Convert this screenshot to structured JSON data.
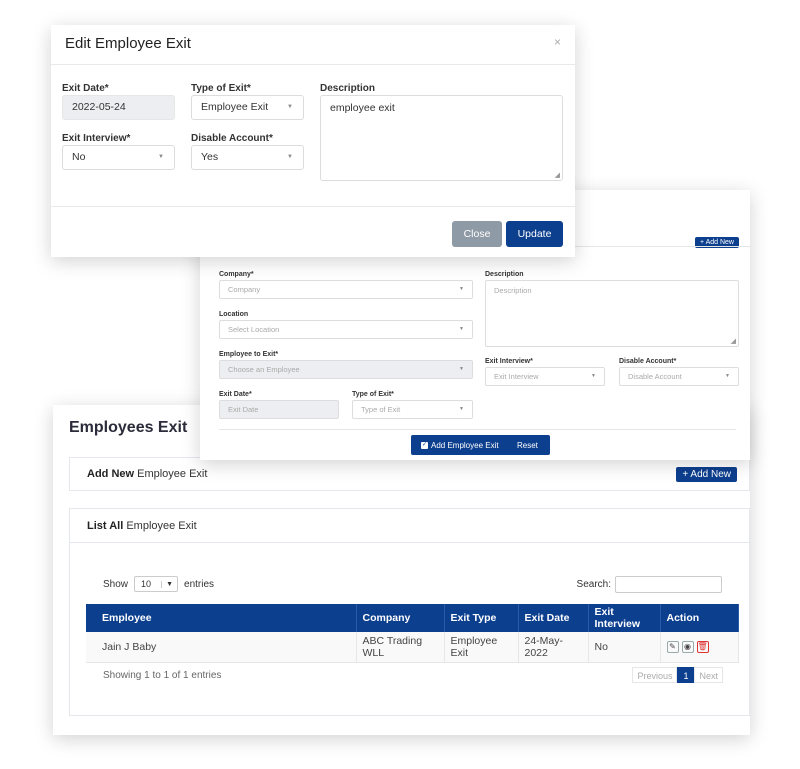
{
  "list_card": {
    "title": "Employees Exit",
    "add_panel": {
      "title_bold": "Add New",
      "title_rest": " Employee Exit",
      "add_button": "+ Add New"
    },
    "list_panel": {
      "title_bold": "List All",
      "title_rest": " Employee Exit"
    },
    "length": {
      "show": "Show",
      "value": "10",
      "entries": "entries"
    },
    "search": {
      "label": "Search:",
      "value": ""
    },
    "table": {
      "headers": [
        "Employee",
        "Company",
        "Exit Type",
        "Exit Date",
        "Exit Interview",
        "Action"
      ],
      "rows": [
        {
          "employee": "Jain J Baby",
          "company": "ABC Trading WLL",
          "exit_type": "Employee Exit",
          "exit_date": "24-May-2022",
          "exit_interview": "No"
        }
      ]
    },
    "info": "Showing 1 to 1 of 1 entries",
    "pager": {
      "previous": "Previous",
      "current": "1",
      "next": "Next"
    }
  },
  "add_form": {
    "add_button": "+ Add New",
    "company": {
      "label": "Company*",
      "placeholder": "Company"
    },
    "location": {
      "label": "Location",
      "placeholder": "Select Location"
    },
    "employee": {
      "label": "Employee to Exit*",
      "placeholder": "Choose an Employee"
    },
    "exit_date": {
      "label": "Exit Date*",
      "placeholder": "Exit Date"
    },
    "type_of_exit": {
      "label": "Type of Exit*",
      "placeholder": "Type of Exit"
    },
    "description": {
      "label": "Description",
      "placeholder": "Description"
    },
    "exit_interview": {
      "label": "Exit Interview*",
      "placeholder": "Exit Interview"
    },
    "disable_account": {
      "label": "Disable Account*",
      "placeholder": "Disable Account"
    },
    "submit_button": "Add Employee Exit",
    "reset_button": "Reset"
  },
  "edit_modal": {
    "title": "Edit Employee Exit",
    "close_icon": "×",
    "exit_date": {
      "label": "Exit Date*",
      "value": "2022-05-24"
    },
    "type_of_exit": {
      "label": "Type of Exit*",
      "value": "Employee Exit"
    },
    "description": {
      "label": "Description",
      "value": "employee exit"
    },
    "exit_interview": {
      "label": "Exit Interview*",
      "value": "No"
    },
    "disable_account": {
      "label": "Disable Account*",
      "value": "Yes"
    },
    "close_button": "Close",
    "update_button": "Update"
  },
  "colors": {
    "primary": "#0d3f8f",
    "close_button": "#8e9aa6",
    "danger": "#dd3333"
  }
}
